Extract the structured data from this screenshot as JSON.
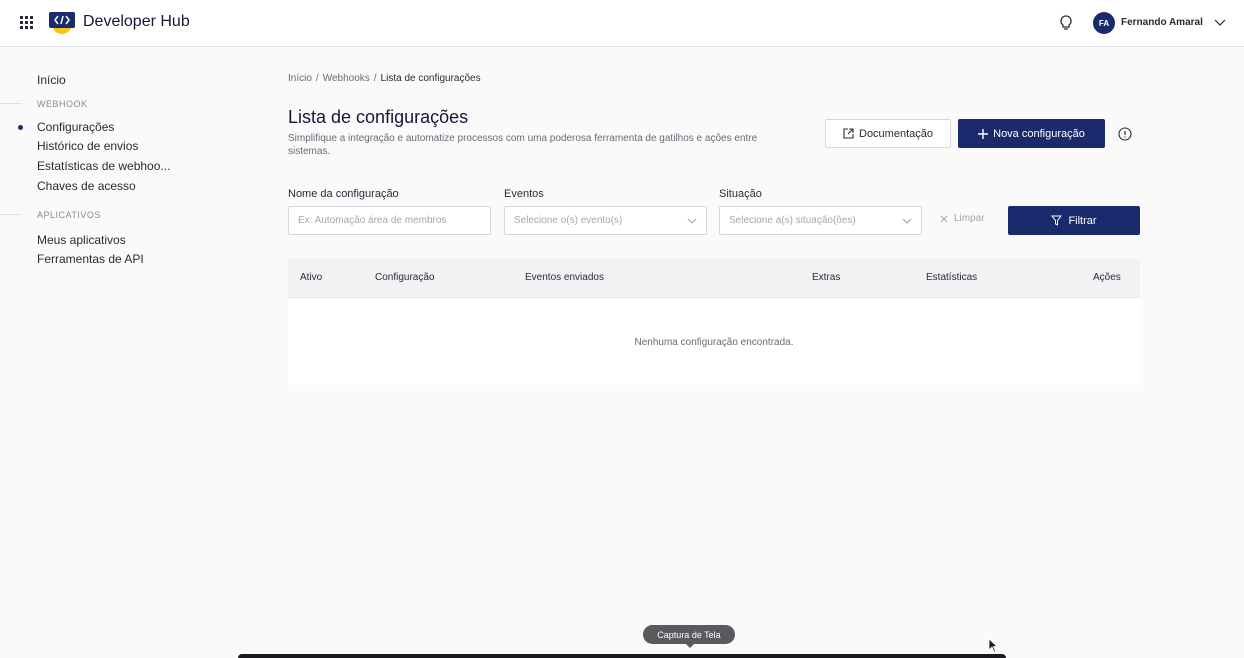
{
  "header": {
    "brand": "Developer Hub",
    "user_initials": "FA",
    "user_name": "Fernando Amaral"
  },
  "sidebar": {
    "home": "Início",
    "webhook_section": "WEBHOOK",
    "webhook_items": [
      "Configurações",
      "Histórico de envios",
      "Estatísticas de webhoo...",
      "Chaves de acesso"
    ],
    "apps_section": "APLICATIVOS",
    "apps_items": [
      "Meus aplicativos",
      "Ferramentas de API"
    ]
  },
  "breadcrumb": {
    "items": [
      "Início",
      "Webhooks",
      "Lista de configurações"
    ]
  },
  "page": {
    "title": "Lista de configurações",
    "description": "Simplifique a integração e automatize processos com uma poderosa ferramenta de gatilhos e ações entre sistemas."
  },
  "actions": {
    "docs_label": "Documentação",
    "new_label": "Nova configuração"
  },
  "filters": {
    "name_label": "Nome da configuração",
    "name_placeholder": "Ex: Automação área de membros",
    "events_label": "Eventos",
    "events_placeholder": "Selecione o(s) evento(s)",
    "status_label": "Situação",
    "status_placeholder": "Selecione a(s) situação(ões)",
    "clear_label": "Limpar",
    "filter_label": "Filtrar"
  },
  "table": {
    "columns": [
      "Ativo",
      "Configuração",
      "Eventos enviados",
      "Extras",
      "Estatísticas",
      "Ações"
    ],
    "empty_message": "Nenhuma configuração encontrada."
  },
  "tooltip": "Captura de Tela",
  "colors": {
    "primary": "#1a2a6c",
    "logo_yellow": "#f5c518"
  }
}
